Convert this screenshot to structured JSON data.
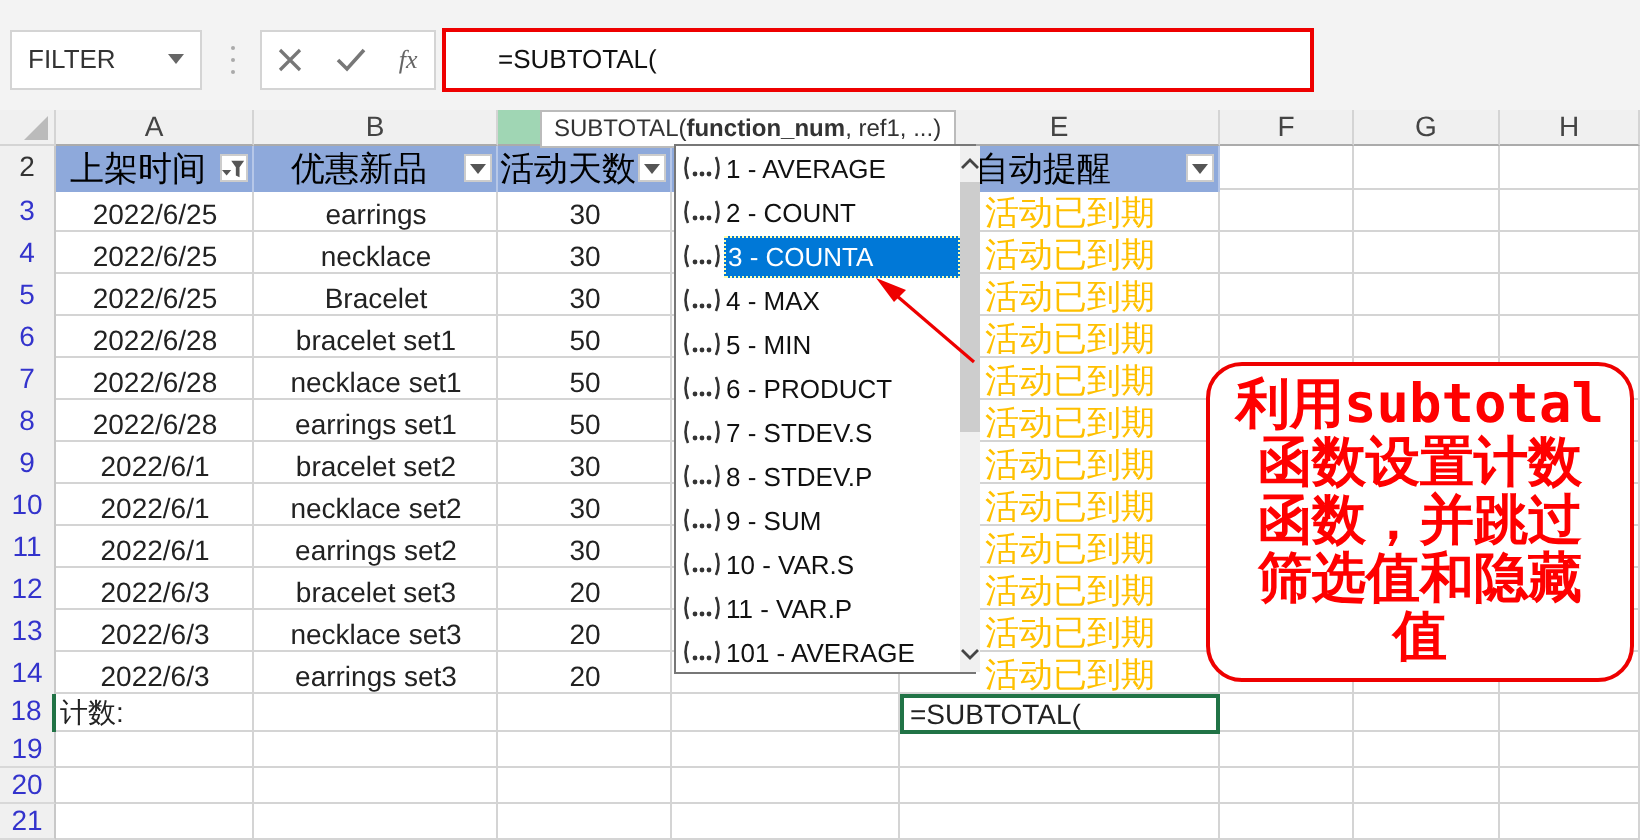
{
  "formula_bar": {
    "name_box": "FILTER",
    "fx": "fx",
    "formula": "=SUBTOTAL("
  },
  "column_headers": [
    "A",
    "B",
    "E",
    "F",
    "G",
    "H"
  ],
  "header_row": {
    "num": "2",
    "cells": [
      {
        "text": "上架时间",
        "filtered": true
      },
      {
        "text": "优惠新品",
        "filtered": false
      },
      {
        "text": "活动天数",
        "filtered": false
      },
      {
        "text": "自动提醒",
        "filtered": false
      }
    ]
  },
  "rows": [
    {
      "kind": "data",
      "num": "3",
      "date": "2022/6/25",
      "item": "earrings",
      "days": "30",
      "reminder": "活动已到期"
    },
    {
      "kind": "data",
      "num": "4",
      "date": "2022/6/25",
      "item": "necklace",
      "days": "30",
      "reminder": "活动已到期"
    },
    {
      "kind": "data",
      "num": "5",
      "date": "2022/6/25",
      "item": "Bracelet",
      "days": "30",
      "reminder": "活动已到期"
    },
    {
      "kind": "data",
      "num": "6",
      "date": "2022/6/28",
      "item": "bracelet set1",
      "days": "50",
      "reminder": "活动已到期"
    },
    {
      "kind": "data",
      "num": "7",
      "date": "2022/6/28",
      "item": "necklace set1",
      "days": "50",
      "reminder": "活动已到期"
    },
    {
      "kind": "data",
      "num": "8",
      "date": "2022/6/28",
      "item": "earrings set1",
      "days": "50",
      "reminder": "活动已到期"
    },
    {
      "kind": "data",
      "num": "9",
      "date": "2022/6/1",
      "item": "bracelet set2",
      "days": "30",
      "reminder": "活动已到期"
    },
    {
      "kind": "data",
      "num": "10",
      "date": "2022/6/1",
      "item": "necklace set2",
      "days": "30",
      "reminder": "活动已到期"
    },
    {
      "kind": "data",
      "num": "11",
      "date": "2022/6/1",
      "item": "earrings set2",
      "days": "30",
      "reminder": "活动已到期"
    },
    {
      "kind": "data",
      "num": "12",
      "date": "2022/6/3",
      "item": "bracelet set3",
      "days": "20",
      "reminder": "活动已到期"
    },
    {
      "kind": "data",
      "num": "13",
      "date": "2022/6/3",
      "item": "necklace set3",
      "days": "20",
      "reminder": "活动已到期"
    },
    {
      "kind": "data",
      "num": "14",
      "date": "2022/6/3",
      "item": "earrings set3",
      "days": "20",
      "reminder": "活动已到期"
    },
    {
      "kind": "total",
      "num": "18",
      "label": "计数:",
      "formula": "=SUBTOTAL("
    },
    {
      "kind": "empty",
      "num": "19"
    },
    {
      "kind": "empty",
      "num": "20"
    },
    {
      "kind": "empty",
      "num": "21"
    }
  ],
  "tooltip": "SUBTOTAL(**function_num**, ref1, ...)",
  "function_list": [
    {
      "label": "1 - AVERAGE",
      "selected": false
    },
    {
      "label": "2 - COUNT",
      "selected": false
    },
    {
      "label": "3 - COUNTA",
      "selected": true
    },
    {
      "label": "4 - MAX",
      "selected": false
    },
    {
      "label": "5 - MIN",
      "selected": false
    },
    {
      "label": "6 - PRODUCT",
      "selected": false
    },
    {
      "label": "7 - STDEV.S",
      "selected": false
    },
    {
      "label": "8 - STDEV.P",
      "selected": false
    },
    {
      "label": "9 - SUM",
      "selected": false
    },
    {
      "label": "10 - VAR.S",
      "selected": false
    },
    {
      "label": "11 - VAR.P",
      "selected": false
    },
    {
      "label": "101 - AVERAGE",
      "selected": false
    }
  ],
  "callout": "利用subtotal函数设置计数函数，并跳过筛选值和隐藏值"
}
